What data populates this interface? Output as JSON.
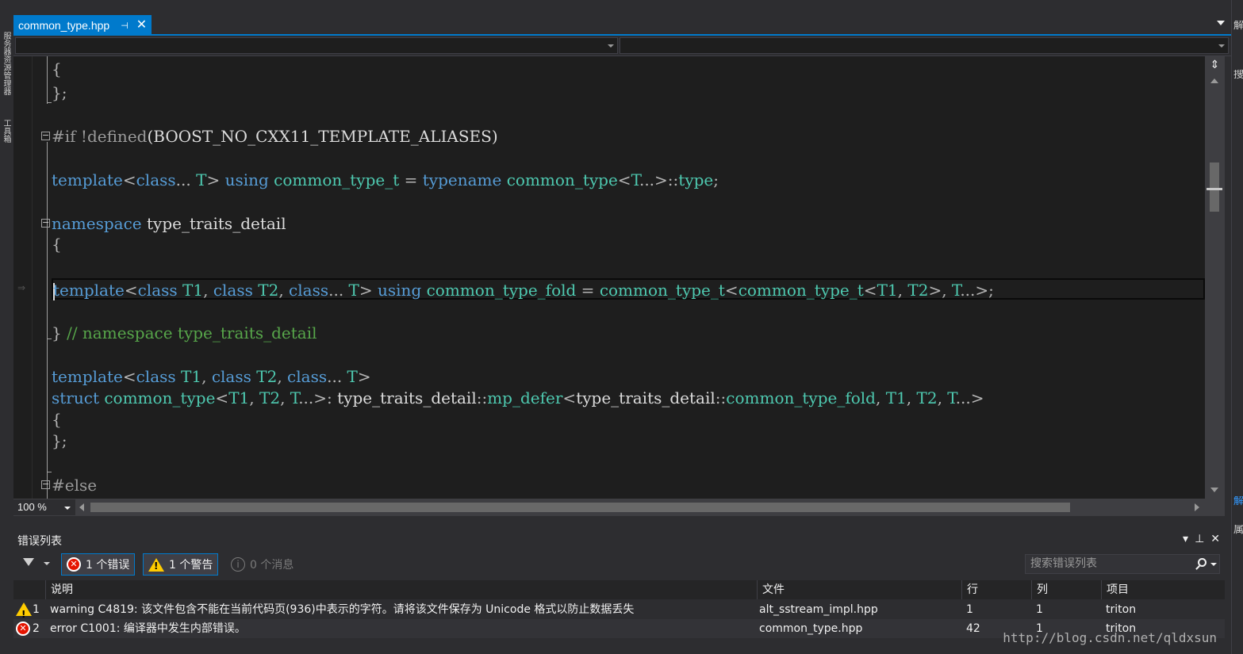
{
  "left_strip": {
    "labels": [
      "服务器资源管理器",
      "工具箱"
    ]
  },
  "right_strip": {
    "labels": [
      "解",
      "搜",
      "解",
      "属"
    ]
  },
  "editor_tab": {
    "filename": "common_type.hpp",
    "pin_glyph": "⊣",
    "close_glyph": "✕"
  },
  "zoom": "100 %",
  "code": {
    "lines": [
      {
        "tokens": [
          {
            "t": "{",
            "c": "pn"
          }
        ]
      },
      {
        "tokens": [
          {
            "t": "};",
            "c": "pn"
          }
        ]
      },
      {
        "tokens": [
          {
            "t": "#if",
            "c": "pp"
          },
          {
            "t": " !defined",
            "c": "pp"
          },
          {
            "t": "(BOOST_NO_CXX11_TEMPLATE_ALIASES)",
            "c": "id"
          }
        ]
      },
      {
        "tokens": [
          {
            "t": "template",
            "c": "kw"
          },
          {
            "t": "<",
            "c": "pn"
          },
          {
            "t": "class",
            "c": "kw"
          },
          {
            "t": "... ",
            "c": "pn"
          },
          {
            "t": "T",
            "c": "ty"
          },
          {
            "t": "> ",
            "c": "pn"
          },
          {
            "t": "using",
            "c": "kw"
          },
          {
            "t": " ",
            "c": "id"
          },
          {
            "t": "common_type_t",
            "c": "ty"
          },
          {
            "t": " = ",
            "c": "pn"
          },
          {
            "t": "typename",
            "c": "kw"
          },
          {
            "t": " ",
            "c": "id"
          },
          {
            "t": "common_type",
            "c": "ty"
          },
          {
            "t": "<",
            "c": "pn"
          },
          {
            "t": "T",
            "c": "ty"
          },
          {
            "t": "...>::",
            "c": "pn"
          },
          {
            "t": "type",
            "c": "ty"
          },
          {
            "t": ";",
            "c": "pn"
          }
        ]
      },
      {
        "tokens": [
          {
            "t": "namespace",
            "c": "kw"
          },
          {
            "t": " type_traits_detail",
            "c": "id"
          }
        ]
      },
      {
        "tokens": [
          {
            "t": "{",
            "c": "pn"
          }
        ]
      },
      {
        "tokens": [
          {
            "t": "template",
            "c": "kw"
          },
          {
            "t": "<",
            "c": "pn"
          },
          {
            "t": "class",
            "c": "kw"
          },
          {
            "t": " ",
            "c": "id"
          },
          {
            "t": "T1",
            "c": "ty"
          },
          {
            "t": ", ",
            "c": "pn"
          },
          {
            "t": "class",
            "c": "kw"
          },
          {
            "t": " ",
            "c": "id"
          },
          {
            "t": "T2",
            "c": "ty"
          },
          {
            "t": ", ",
            "c": "pn"
          },
          {
            "t": "class",
            "c": "kw"
          },
          {
            "t": "... ",
            "c": "pn"
          },
          {
            "t": "T",
            "c": "ty"
          },
          {
            "t": "> ",
            "c": "pn"
          },
          {
            "t": "using",
            "c": "kw"
          },
          {
            "t": " ",
            "c": "id"
          },
          {
            "t": "common_type_fold",
            "c": "ty"
          },
          {
            "t": " = ",
            "c": "pn"
          },
          {
            "t": "common_type_t",
            "c": "ty"
          },
          {
            "t": "<",
            "c": "pn"
          },
          {
            "t": "common_type_t",
            "c": "ty"
          },
          {
            "t": "<",
            "c": "pn"
          },
          {
            "t": "T1",
            "c": "ty"
          },
          {
            "t": ", ",
            "c": "pn"
          },
          {
            "t": "T2",
            "c": "ty"
          },
          {
            "t": ">, ",
            "c": "pn"
          },
          {
            "t": "T",
            "c": "ty"
          },
          {
            "t": "...>;",
            "c": "pn"
          }
        ]
      },
      {
        "tokens": [
          {
            "t": "} ",
            "c": "pn"
          },
          {
            "t": "// namespace type_traits_detail",
            "c": "cm"
          }
        ]
      },
      {
        "tokens": [
          {
            "t": "template",
            "c": "kw"
          },
          {
            "t": "<",
            "c": "pn"
          },
          {
            "t": "class",
            "c": "kw"
          },
          {
            "t": " ",
            "c": "id"
          },
          {
            "t": "T1",
            "c": "ty"
          },
          {
            "t": ", ",
            "c": "pn"
          },
          {
            "t": "class",
            "c": "kw"
          },
          {
            "t": " ",
            "c": "id"
          },
          {
            "t": "T2",
            "c": "ty"
          },
          {
            "t": ", ",
            "c": "pn"
          },
          {
            "t": "class",
            "c": "kw"
          },
          {
            "t": "... ",
            "c": "pn"
          },
          {
            "t": "T",
            "c": "ty"
          },
          {
            "t": ">",
            "c": "pn"
          }
        ]
      },
      {
        "tokens": [
          {
            "t": "struct",
            "c": "kw"
          },
          {
            "t": " ",
            "c": "id"
          },
          {
            "t": "common_type",
            "c": "ty"
          },
          {
            "t": "<",
            "c": "pn"
          },
          {
            "t": "T1",
            "c": "ty"
          },
          {
            "t": ", ",
            "c": "pn"
          },
          {
            "t": "T2",
            "c": "ty"
          },
          {
            "t": ", ",
            "c": "pn"
          },
          {
            "t": "T",
            "c": "ty"
          },
          {
            "t": "...>: ",
            "c": "pn"
          },
          {
            "t": "type_traits_detail",
            "c": "id"
          },
          {
            "t": "::",
            "c": "pn"
          },
          {
            "t": "mp_defer",
            "c": "ty"
          },
          {
            "t": "<",
            "c": "pn"
          },
          {
            "t": "type_traits_detail",
            "c": "id"
          },
          {
            "t": "::",
            "c": "pn"
          },
          {
            "t": "common_type_fold",
            "c": "ty"
          },
          {
            "t": ", ",
            "c": "pn"
          },
          {
            "t": "T1",
            "c": "ty"
          },
          {
            "t": ", ",
            "c": "pn"
          },
          {
            "t": "T2",
            "c": "ty"
          },
          {
            "t": ", ",
            "c": "pn"
          },
          {
            "t": "T",
            "c": "ty"
          },
          {
            "t": "...>",
            "c": "pn"
          }
        ]
      },
      {
        "tokens": [
          {
            "t": "{",
            "c": "pn"
          }
        ]
      },
      {
        "tokens": [
          {
            "t": "};",
            "c": "pn"
          }
        ]
      },
      {
        "tokens": [
          {
            "t": "#else",
            "c": "pp"
          }
        ]
      }
    ]
  },
  "error_list": {
    "title": "错误列表",
    "panel_controls": [
      "▾",
      "⊥",
      "✕"
    ],
    "filters": {
      "errors": "1 个错误",
      "warnings": "1 个警告",
      "messages": "0 个消息"
    },
    "search_placeholder": "搜索错误列表",
    "columns": {
      "description": "说明",
      "file": "文件",
      "line": "行",
      "column": "列",
      "project": "项目"
    },
    "rows": [
      {
        "severity": "warning",
        "num": "1",
        "description": "warning C4819: 该文件包含不能在当前代码页(936)中表示的字符。请将该文件保存为 Unicode 格式以防止数据丢失",
        "file": "alt_sstream_impl.hpp",
        "line": "1",
        "column": "1",
        "project": "triton"
      },
      {
        "severity": "error",
        "num": "2",
        "description": "error C1001: 编译器中发生内部错误。",
        "file": "common_type.hpp",
        "line": "42",
        "column": "1",
        "project": "triton"
      }
    ]
  },
  "watermark": "http://blog.csdn.net/qldxsun",
  "colors": {
    "accent": "#007acc",
    "editor_bg": "#1e1e1e",
    "keyword": "#569cd6",
    "type": "#4ec9b0",
    "comment": "#57a64a",
    "preprocessor": "#9b9b9b",
    "error": "#e51400",
    "warning": "#ffcc00"
  }
}
